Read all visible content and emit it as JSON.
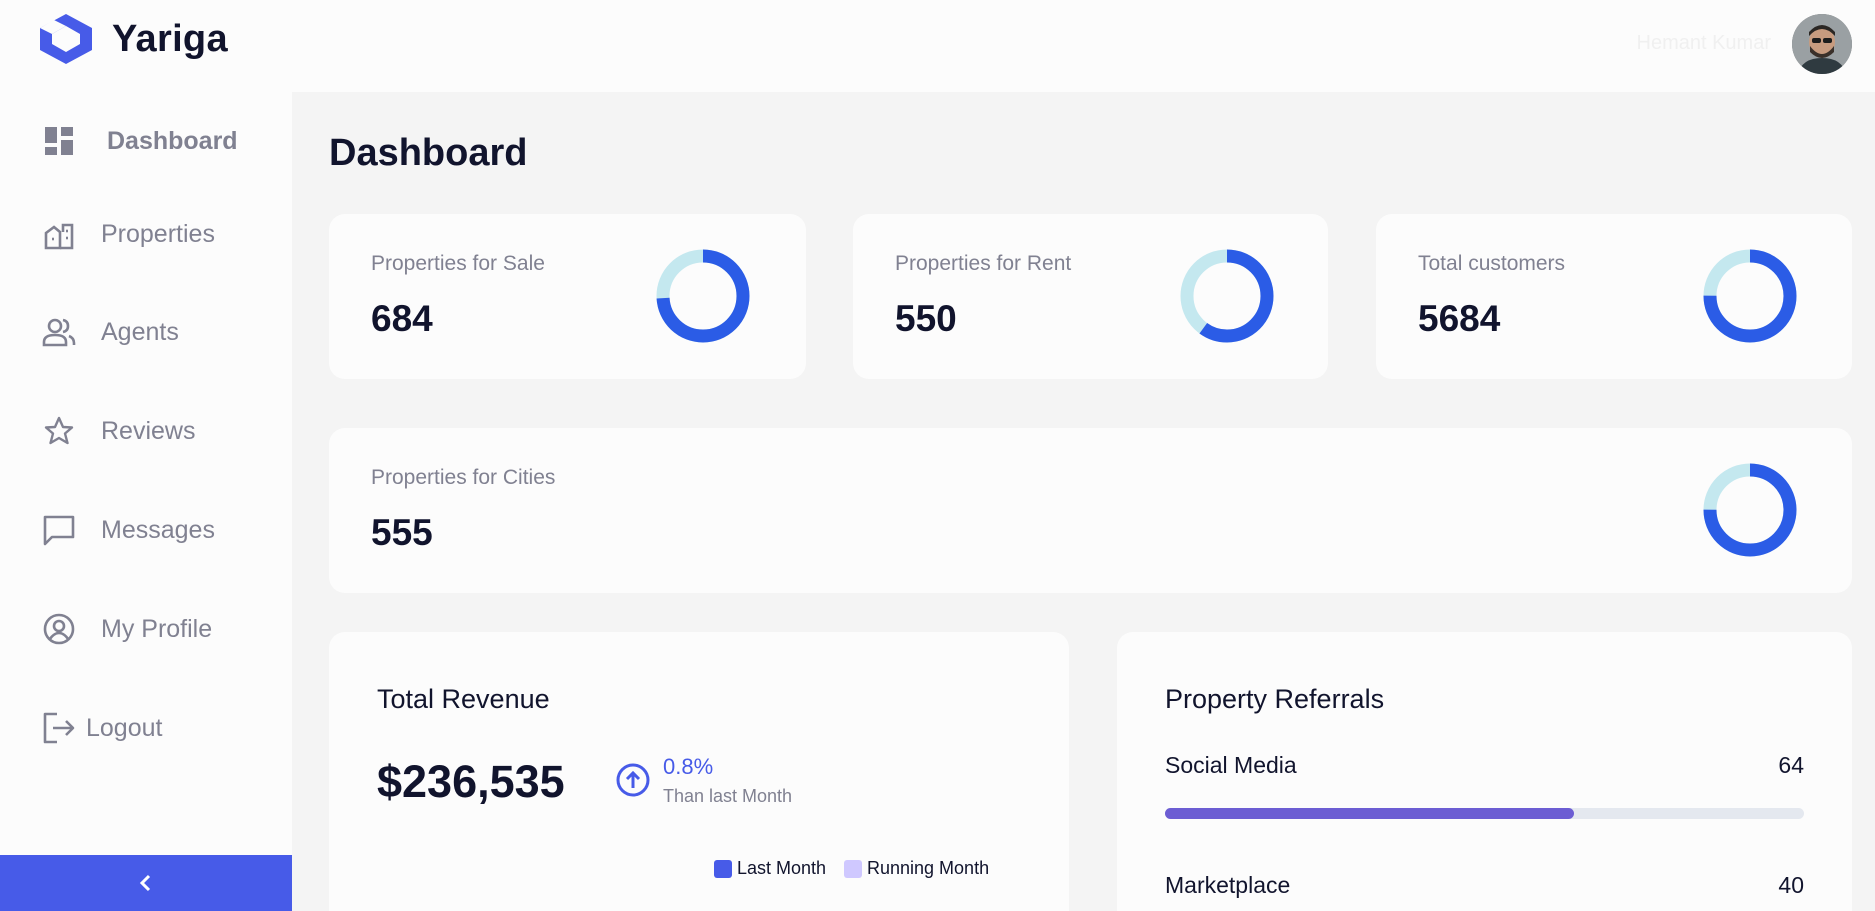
{
  "app": {
    "name": "Yariga"
  },
  "user": {
    "name": "Hemant Kumar"
  },
  "sidebar": {
    "items": [
      {
        "label": "Dashboard",
        "icon": "dashboard-icon",
        "active": true
      },
      {
        "label": "Properties",
        "icon": "properties-icon"
      },
      {
        "label": "Agents",
        "icon": "agents-icon"
      },
      {
        "label": "Reviews",
        "icon": "star-icon"
      },
      {
        "label": "Messages",
        "icon": "message-icon"
      },
      {
        "label": "My Profile",
        "icon": "profile-icon"
      },
      {
        "label": "Logout",
        "icon": "logout-icon"
      }
    ],
    "collapse_icon": "chevron-left-icon"
  },
  "page": {
    "title": "Dashboard"
  },
  "stats": [
    {
      "label": "Properties for Sale",
      "value": "684",
      "fill": 0.74
    },
    {
      "label": "Properties for Rent",
      "value": "550",
      "fill": 0.6
    },
    {
      "label": "Total customers",
      "value": "5684",
      "fill": 0.75
    },
    {
      "label": "Properties for Cities",
      "value": "555",
      "fill": 0.75
    }
  ],
  "revenue": {
    "title": "Total Revenue",
    "value": "$236,535",
    "change": "0.8%",
    "change_label": "Than last Month",
    "legend": [
      {
        "label": "Last Month",
        "color": "#475be8"
      },
      {
        "label": "Running Month",
        "color": "#cfc8ff"
      }
    ]
  },
  "referrals": {
    "title": "Property Referrals",
    "items": [
      {
        "name": "Social Media",
        "value": "64",
        "percent": 64,
        "color": "#6c5dd3"
      },
      {
        "name": "Marketplace",
        "value": "40",
        "percent": 40,
        "color": "#7fba7a"
      }
    ]
  },
  "colors": {
    "primary": "#475be8",
    "donut_blue": "#2b5ce6",
    "donut_light": "#c4e8ef"
  }
}
